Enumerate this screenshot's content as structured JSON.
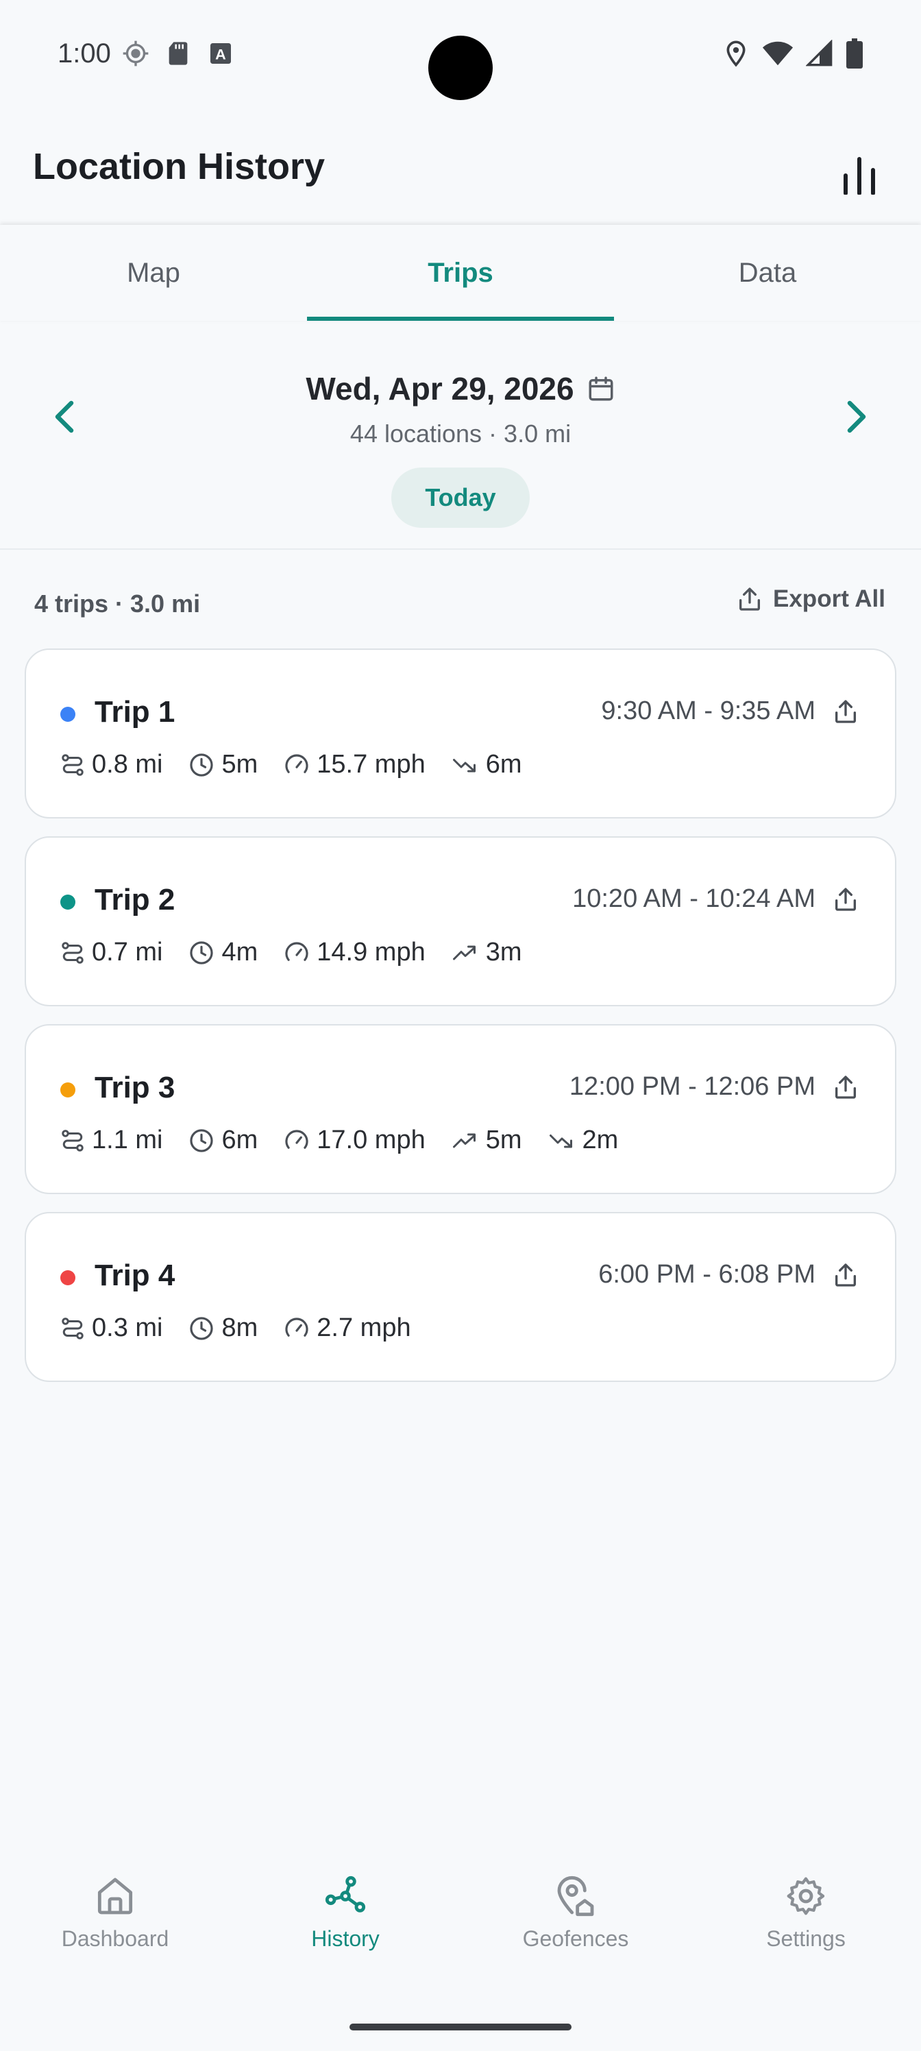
{
  "status_bar": {
    "time": "1:00"
  },
  "app_bar": {
    "title": "Location History"
  },
  "tabs": [
    {
      "label": "Map",
      "active": false
    },
    {
      "label": "Trips",
      "active": true
    },
    {
      "label": "Data",
      "active": false
    }
  ],
  "date_header": {
    "date": "Wed, Apr 29, 2026",
    "subtitle": "44 locations · 3.0 mi",
    "today_label": "Today"
  },
  "summary": {
    "text": "4 trips · 3.0 mi",
    "export_label": "Export All"
  },
  "trips": [
    {
      "name": "Trip 1",
      "color": "#3b82f6",
      "time": "9:30 AM - 9:35 AM",
      "distance": "0.8 mi",
      "duration": "5m",
      "speed": "15.7 mph",
      "down": "6m"
    },
    {
      "name": "Trip 2",
      "color": "#0d9488",
      "time": "10:20 AM - 10:24 AM",
      "distance": "0.7 mi",
      "duration": "4m",
      "speed": "14.9 mph",
      "up": "3m"
    },
    {
      "name": "Trip 3",
      "color": "#f59e0b",
      "time": "12:00 PM - 12:06 PM",
      "distance": "1.1 mi",
      "duration": "6m",
      "speed": "17.0 mph",
      "up": "5m",
      "down": "2m"
    },
    {
      "name": "Trip 4",
      "color": "#ef4444",
      "time": "6:00 PM - 6:08 PM",
      "distance": "0.3 mi",
      "duration": "8m",
      "speed": "2.7 mph"
    }
  ],
  "bottom_nav": [
    {
      "label": "Dashboard",
      "icon": "home-icon",
      "active": false
    },
    {
      "label": "History",
      "icon": "route-icon",
      "active": true
    },
    {
      "label": "Geofences",
      "icon": "geofence-icon",
      "active": false
    },
    {
      "label": "Settings",
      "icon": "gear-icon",
      "active": false
    }
  ],
  "colors": {
    "accent": "#138a7e",
    "accent_bg": "#e4efee",
    "background": "#f7f9fb"
  }
}
